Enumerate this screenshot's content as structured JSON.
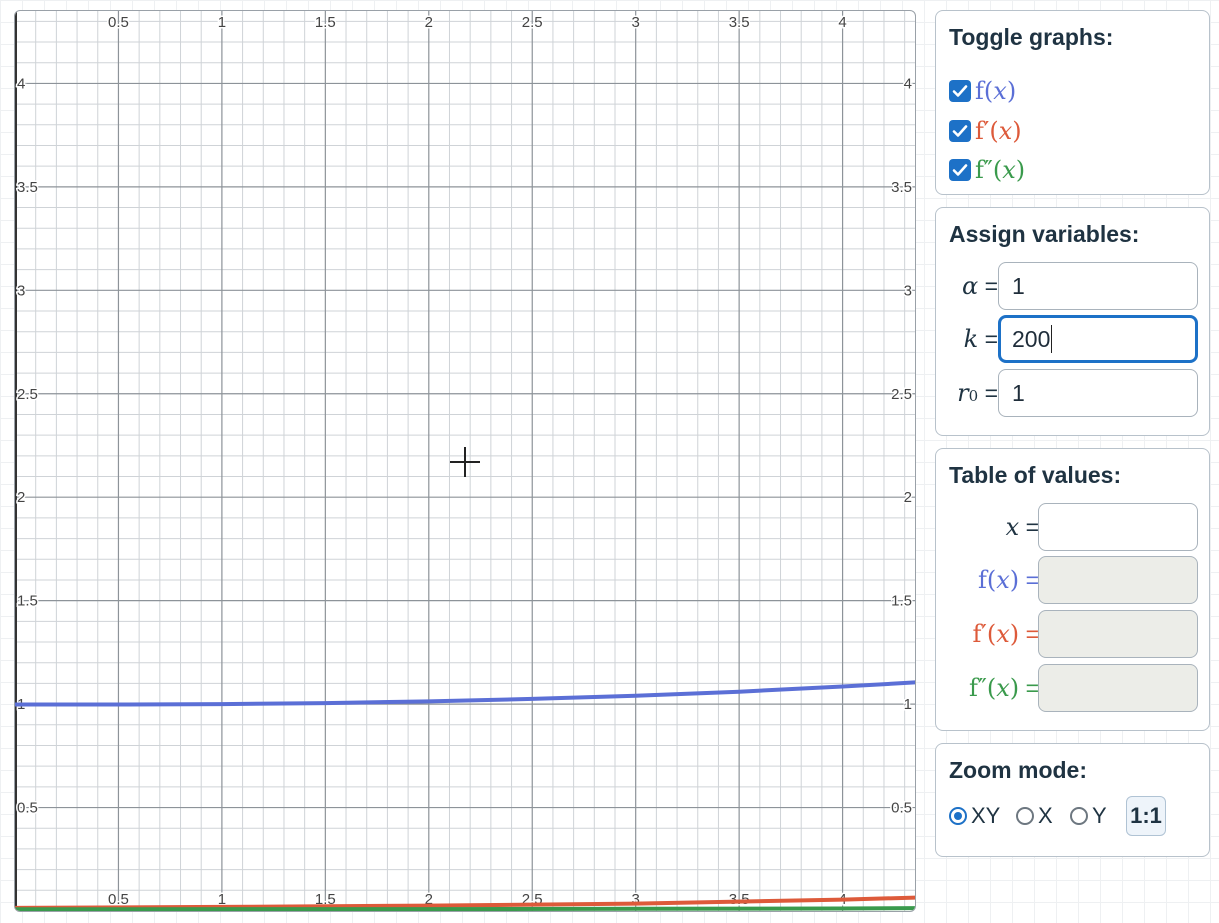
{
  "plot": {
    "x_range": [
      0,
      4.35
    ],
    "y_range": [
      0,
      4.35
    ],
    "x_ticks": [
      "0.5",
      "1",
      "1.5",
      "2",
      "2.5",
      "3",
      "3.5",
      "4"
    ],
    "y_ticks": [
      "0.5",
      "1",
      "1.5",
      "2",
      "2.5",
      "3",
      "3.5",
      "4"
    ],
    "curves": [
      {
        "name": "f(x)",
        "color": "#5b6fd6",
        "points": [
          [
            0,
            0.998
          ],
          [
            0.5,
            0.998
          ],
          [
            1,
            1.0
          ],
          [
            1.5,
            1.005
          ],
          [
            2,
            1.013
          ],
          [
            2.5,
            1.025
          ],
          [
            3,
            1.04
          ],
          [
            3.5,
            1.06
          ],
          [
            4,
            1.085
          ],
          [
            4.35,
            1.105
          ]
        ]
      },
      {
        "name": "f'(x)",
        "color": "#dd5a3a",
        "points": [
          [
            0,
            0.015
          ],
          [
            1,
            0.02
          ],
          [
            2,
            0.026
          ],
          [
            3,
            0.036
          ],
          [
            4,
            0.055
          ],
          [
            4.35,
            0.065
          ]
        ]
      },
      {
        "name": "f''(x)",
        "color": "#3a9a4c",
        "points": [
          [
            0,
            0.008
          ],
          [
            2,
            0.009
          ],
          [
            4,
            0.012
          ],
          [
            4.35,
            0.014
          ]
        ]
      }
    ]
  },
  "toggle": {
    "title": "Toggle graphs:",
    "items": [
      {
        "fn": "f",
        "prime": "",
        "var": "x",
        "color": "#5b6fd6",
        "checked": true
      },
      {
        "fn": "f",
        "prime": "′",
        "var": "x",
        "color": "#dd5a3a",
        "checked": true
      },
      {
        "fn": "f",
        "prime": "″",
        "var": "x",
        "color": "#3a9a4c",
        "checked": true
      }
    ]
  },
  "assign": {
    "title": "Assign variables:",
    "vars": [
      {
        "symbol": "α",
        "sub": "",
        "eq": "=",
        "value": "1"
      },
      {
        "symbol": "k",
        "sub": "",
        "eq": "=",
        "value": "200"
      },
      {
        "symbol": "r",
        "sub": "0",
        "eq": "=",
        "value": "1"
      }
    ]
  },
  "table": {
    "title": "Table of values:",
    "x_symbol": "x",
    "eq": "=",
    "x_value": "",
    "rows": [
      {
        "fn": "f",
        "prime": "",
        "var": "x",
        "color": "#5b6fd6",
        "value": ""
      },
      {
        "fn": "f",
        "prime": "′",
        "var": "x",
        "color": "#dd5a3a",
        "value": ""
      },
      {
        "fn": "f",
        "prime": "″",
        "var": "x",
        "color": "#3a9a4c",
        "value": ""
      }
    ]
  },
  "zoom": {
    "title": "Zoom mode:",
    "options": [
      {
        "label": "XY",
        "selected": true
      },
      {
        "label": "X",
        "selected": false
      },
      {
        "label": "Y",
        "selected": false
      }
    ],
    "button": "1:1"
  },
  "colors": {
    "accent": "#1d71c7",
    "grid_major": "#8d9399",
    "grid_minor": "#cfd3d7"
  }
}
